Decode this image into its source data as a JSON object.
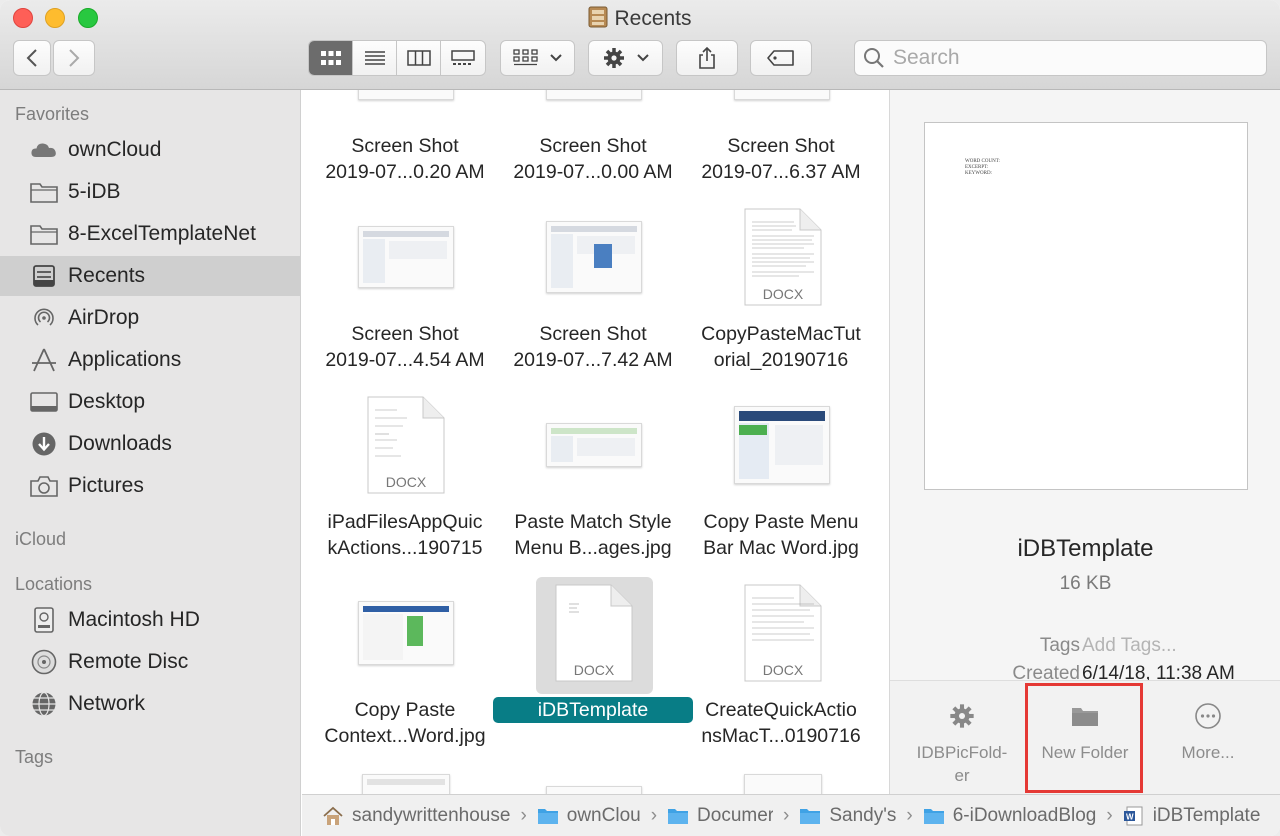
{
  "window": {
    "title": "Recents",
    "title_icon": "recents-drawer-icon"
  },
  "toolbar": {
    "view_modes": [
      "icon-view-icon",
      "list-view-icon",
      "column-view-icon",
      "gallery-view-icon"
    ],
    "active_view": "icon-view-icon",
    "group_icon": "group-by-icon",
    "action_icon": "gear-icon",
    "share_icon": "share-icon",
    "tag_icon": "tag-icon",
    "search_placeholder": "Search"
  },
  "sidebar": {
    "favorites_header": "Favorites",
    "favorites": [
      {
        "label": "ownCloud",
        "icon": "cloud-icon"
      },
      {
        "label": "5-iDB",
        "icon": "folder-icon"
      },
      {
        "label": "8-ExcelTemplateNet",
        "icon": "folder-icon"
      },
      {
        "label": "Recents",
        "icon": "recents-icon",
        "selected": true
      },
      {
        "label": "AirDrop",
        "icon": "airdrop-icon"
      },
      {
        "label": "Applications",
        "icon": "applications-icon"
      },
      {
        "label": "Desktop",
        "icon": "desktop-icon"
      },
      {
        "label": "Downloads",
        "icon": "downloads-icon"
      },
      {
        "label": "Pictures",
        "icon": "camera-icon"
      }
    ],
    "icloud_header": "iCloud",
    "locations_header": "Locations",
    "locations": [
      {
        "label": "Macintosh HD",
        "icon": "hard-drive-icon"
      },
      {
        "label": "Remote Disc",
        "icon": "disc-icon"
      },
      {
        "label": "Network",
        "icon": "network-globe-icon"
      }
    ],
    "tags_header": "Tags"
  },
  "files": [
    {
      "line1": "Screen Shot",
      "line2": "2019-07...0.20 AM",
      "kind": "screenshot"
    },
    {
      "line1": "Screen Shot",
      "line2": "2019-07...0.00 AM",
      "kind": "screenshot"
    },
    {
      "line1": "Screen Shot",
      "line2": "2019-07...6.37 AM",
      "kind": "screenshot"
    },
    {
      "line1": "Screen Shot",
      "line2": "2019-07...4.54 AM",
      "kind": "screenshot"
    },
    {
      "line1": "Screen Shot",
      "line2": "2019-07...7.42 AM",
      "kind": "screenshot"
    },
    {
      "line1": "CopyPasteMacTut",
      "line2": "orial_20190716",
      "kind": "docx",
      "badge": "DOCX"
    },
    {
      "line1": "iPadFilesAppQuic",
      "line2": "kActions...190715",
      "kind": "docx",
      "badge": "DOCX"
    },
    {
      "line1": "Paste Match Style",
      "line2": "Menu B...ages.jpg",
      "kind": "image"
    },
    {
      "line1": "Copy Paste Menu",
      "line2": "Bar Mac Word.jpg",
      "kind": "image"
    },
    {
      "line1": "Copy Paste",
      "line2": "Context...Word.jpg",
      "kind": "image"
    },
    {
      "line1": "iDBTemplate",
      "line2": "",
      "kind": "docx",
      "badge": "DOCX",
      "selected": true
    },
    {
      "line1": "CreateQuickActio",
      "line2": "nsMacT...0190716",
      "kind": "docx",
      "badge": "DOCX"
    }
  ],
  "preview": {
    "doc_text": [
      "WORD COUNT:",
      "EXCERPT:",
      "KEYWORD:"
    ],
    "name": "iDBTemplate",
    "size": "16 KB",
    "tags_label": "Tags",
    "tags_value": "Add Tags...",
    "created_label": "Created",
    "created_value": "6/14/18, 11:38 AM",
    "actions": [
      {
        "label_line1": "IDBPicFold-",
        "label_line2": "er",
        "icon": "gear-icon"
      },
      {
        "label_line1": "New Folder",
        "label_line2": "",
        "icon": "folder-icon"
      },
      {
        "label_line1": "More...",
        "label_line2": "",
        "icon": "ellipsis-circle-icon"
      }
    ]
  },
  "pathbar": [
    {
      "label": "sandywrittenhouse",
      "icon": "home-icon"
    },
    {
      "label": "ownClou",
      "icon": "folder-icon"
    },
    {
      "label": "Documer",
      "icon": "folder-icon"
    },
    {
      "label": "Sandy's",
      "icon": "folder-icon"
    },
    {
      "label": "6-iDownloadBlog",
      "icon": "folder-icon"
    },
    {
      "label": "iDBTemplate",
      "icon": "word-doc-icon"
    }
  ],
  "colors": {
    "selection_label": "#087d86",
    "highlight_box": "#e53935",
    "folder_blue": "#3fa2e5",
    "sidebar_bg": "#e7e6e6"
  }
}
